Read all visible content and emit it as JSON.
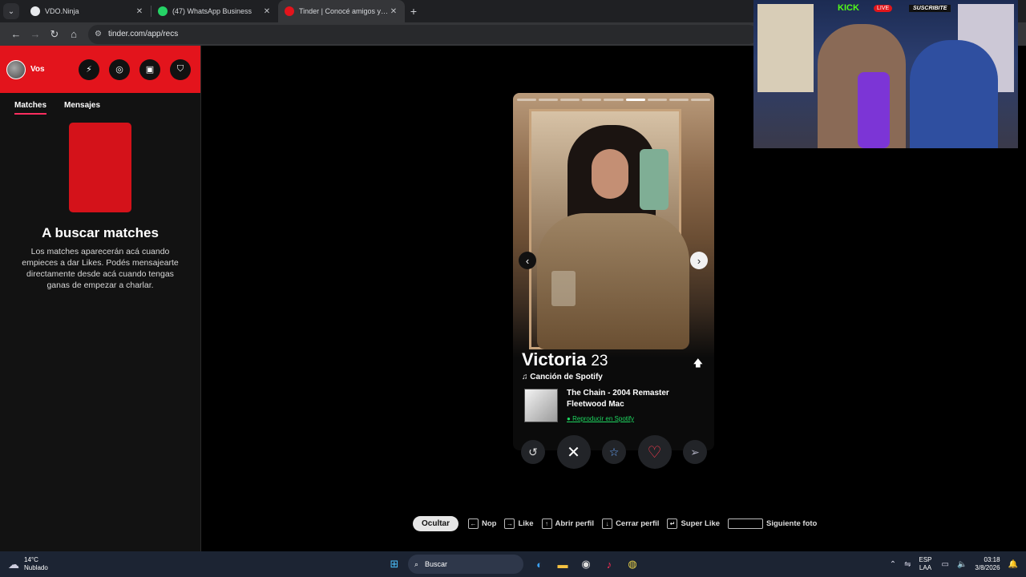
{
  "browser": {
    "tabs": [
      {
        "title": "VDO.Ninja",
        "favicon_color": "#e8eaed",
        "active": false
      },
      {
        "title": "(47) WhatsApp Business",
        "favicon_color": "#25d366",
        "active": false
      },
      {
        "title": "Tinder | Conocé amigos y gente",
        "favicon_color": "#e3141c",
        "active": true
      }
    ],
    "url": "tinder.com/app/recs"
  },
  "sidebar": {
    "profile_name": "Vos",
    "tabs": [
      "Matches",
      "Mensajes"
    ],
    "empty_title": "A buscar matches",
    "empty_text": "Los matches aparecerán acá cuando empieces a dar Likes. Podés mensajearte directamente desde acá cuando tengas ganas de empezar a charlar."
  },
  "card": {
    "name": "Victoria",
    "age": "23",
    "photo_count": 9,
    "photo_index": 6,
    "spotify_label": "Canción de Spotify",
    "track_title": "The Chain - 2004 Remaster",
    "track_artist": "Fleetwood Mac",
    "spotify_link": "Reproducir en Spotify"
  },
  "shortcuts": {
    "hide": "Ocultar",
    "nope": "Nop",
    "like": "Like",
    "open": "Abrir perfil",
    "close": "Cerrar perfil",
    "super": "Super Like",
    "next": "Siguiente foto"
  },
  "webcam": {
    "kick": "KICK",
    "live": "LIVE",
    "subscribe": "SUSCRIBITE"
  },
  "taskbar": {
    "temp": "14°C",
    "weather": "Nublado",
    "search": "Buscar",
    "lang1": "ESP",
    "lang2": "LAA",
    "time": "03:18",
    "date": "3/8/2026"
  }
}
